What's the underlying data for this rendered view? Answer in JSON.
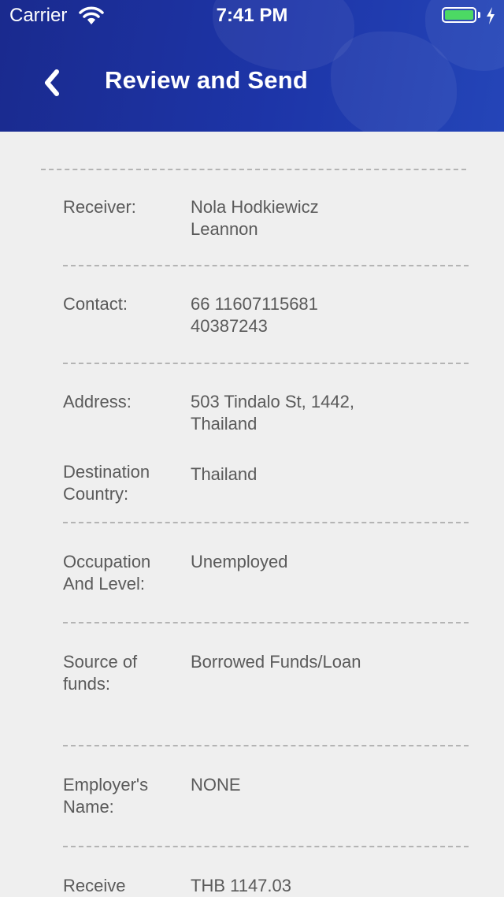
{
  "status_bar": {
    "carrier": "Carrier",
    "time": "7:41 PM",
    "battery_level": 1.0,
    "battery_color": "#4cd964"
  },
  "header": {
    "title": "Review and Send",
    "back_icon": "chevron-left-icon",
    "background_color": "#1d35a8"
  },
  "details": [
    {
      "label": "Receiver:",
      "value": "Nola Hodkiewicz Leannon"
    },
    {
      "label": "Contact:",
      "value": "66 11607115681 40387243"
    },
    {
      "label": "Address:",
      "value": "503 Tindalo St, 1442, Thailand"
    },
    {
      "label": "Destination Country:",
      "value": "Thailand"
    },
    {
      "label": "Occupation And Level:",
      "value": "Unemployed"
    },
    {
      "label": "Source of funds:",
      "value": "Borrowed Funds/Loan"
    },
    {
      "label": "Employer's Name:",
      "value": "NONE"
    },
    {
      "label": "Receive",
      "value": "THB 1147.03"
    }
  ]
}
